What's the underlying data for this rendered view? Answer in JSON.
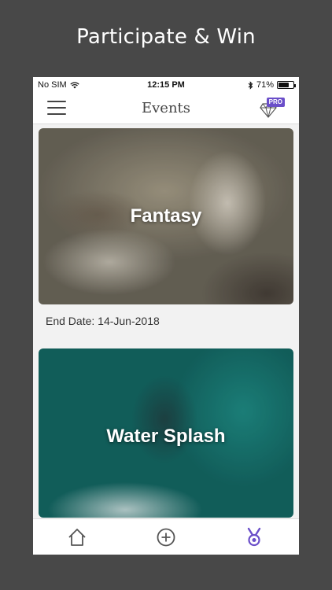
{
  "promo": {
    "headline": "Participate & Win"
  },
  "status_bar": {
    "carrier": "No SIM",
    "time": "12:15 PM",
    "battery": "71%",
    "battery_level": 0.71
  },
  "nav": {
    "title": "Events",
    "pro_badge": "PRO"
  },
  "events": [
    {
      "title": "Fantasy",
      "end_date": "End Date: 14-Jun-2018"
    },
    {
      "title": "Water Splash"
    }
  ],
  "tab_bar": {
    "items": [
      "home-icon",
      "add-circle-icon",
      "medal-icon"
    ],
    "active": "medal-icon"
  },
  "colors": {
    "accent": "#6a4ec9",
    "background": "#484848",
    "icon_inactive": "#555555"
  }
}
